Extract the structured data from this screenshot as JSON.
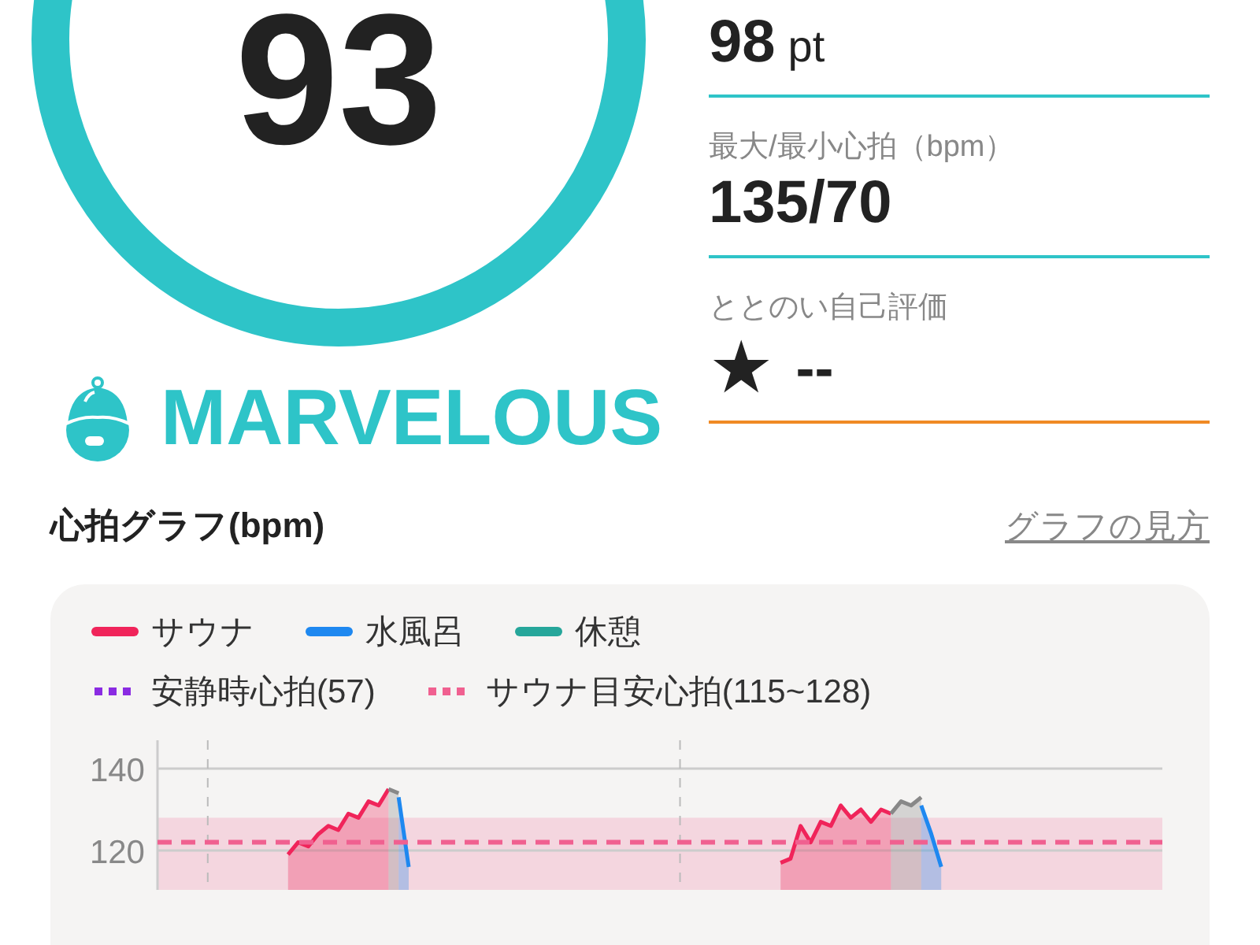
{
  "score": {
    "value": "93",
    "level_label": "MARVELOUS",
    "color": "#2ec4c8"
  },
  "stats": [
    {
      "kind": "points",
      "value": "98",
      "unit": "pt",
      "color": "#2ec4c8"
    },
    {
      "kind": "value",
      "label": "最大/最小心拍（bpm）",
      "value": "135/70",
      "color": "#2ec4c8"
    },
    {
      "kind": "rating",
      "label": "ととのい自己評価",
      "star": "★",
      "value": "--",
      "color": "#f08a24"
    }
  ],
  "heart_rate": {
    "title": "心拍グラフ(bpm)",
    "help_link": "グラフの見方",
    "legend": [
      {
        "label": "サウナ",
        "color": "#f0245a",
        "kind": "solid"
      },
      {
        "label": "水風呂",
        "color": "#1e88f0",
        "kind": "solid"
      },
      {
        "label": "休憩",
        "color": "#26a69a",
        "kind": "solid"
      },
      {
        "label": "安静時心拍(57)",
        "color": "#8a2be2",
        "kind": "dotted"
      },
      {
        "label": "サウナ目安心拍(115~128)",
        "color": "#f06090",
        "kind": "dotted"
      }
    ],
    "y_axis_labels": [
      "140",
      "120"
    ]
  }
}
